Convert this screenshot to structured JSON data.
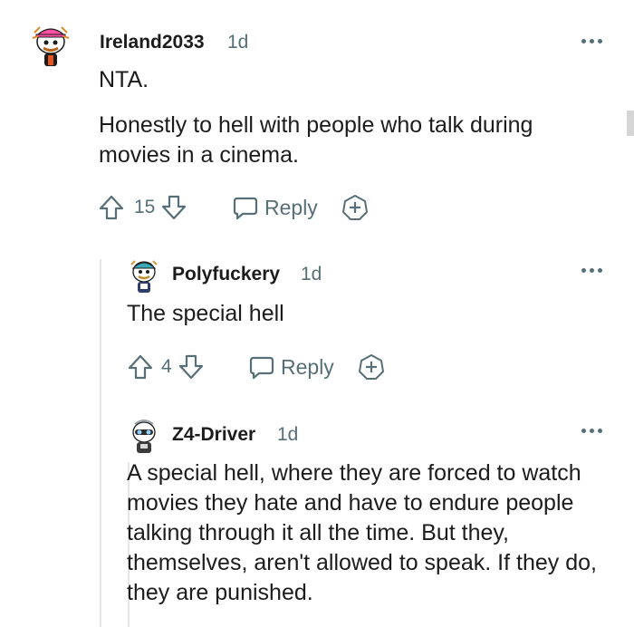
{
  "comments": [
    {
      "username": "Ireland2033",
      "time": "1d",
      "paragraphs": [
        "NTA.",
        "Honestly to hell with people who talk during movies in a cinema."
      ],
      "votes": "15",
      "reply_label": "Reply"
    },
    {
      "username": "Polyfuckery",
      "time": "1d",
      "paragraphs": [
        "The special hell"
      ],
      "votes": "4",
      "reply_label": "Reply"
    },
    {
      "username": "Z4-Driver",
      "time": "1d",
      "paragraphs": [
        "A special hell, where they are forced to watch movies they hate and have to endure people talking through it all the time. But they, themselves, aren't allowed to speak. If they do, they are punished."
      ]
    }
  ],
  "colors": {
    "text": "#1c1c1c",
    "meta": "#576f76",
    "thread_line": "#e5e7e8"
  },
  "icons": [
    "more-options-icon",
    "upvote-icon",
    "downvote-icon",
    "reply-bubble-icon",
    "award-plus-icon"
  ]
}
